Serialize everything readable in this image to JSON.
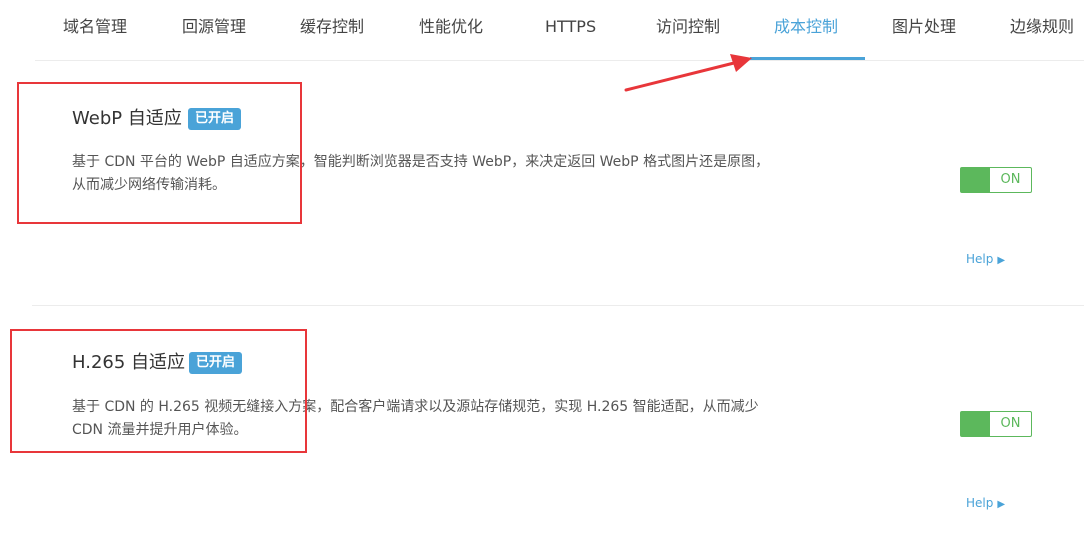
{
  "tabs": [
    {
      "label": "域名管理"
    },
    {
      "label": "回源管理"
    },
    {
      "label": "缓存控制"
    },
    {
      "label": "性能优化"
    },
    {
      "label": "HTTPS"
    },
    {
      "label": "访问控制"
    },
    {
      "label": "成本控制",
      "active": true
    },
    {
      "label": "图片处理"
    },
    {
      "label": "边缘规则"
    }
  ],
  "features": [
    {
      "title": "WebP 自适应",
      "badge": "已开启",
      "description": "基于 CDN 平台的 WebP 自适应方案，智能判断浏览器是否支持 WebP，来决定返回 WebP 格式图片还是原图，从而减少网络传输消耗。",
      "toggle_state": "ON",
      "help_label": "Help"
    },
    {
      "title": "H.265 自适应",
      "badge": "已开启",
      "description": "基于 CDN 的 H.265 视频无缝接入方案，配合客户端请求以及源站存储规范，实现 H.265 智能适配，从而减少 CDN 流量并提升用户体验。",
      "toggle_state": "ON",
      "help_label": "Help"
    }
  ],
  "colors": {
    "accent": "#4aa3d8",
    "toggle_on": "#5cb85c",
    "annotation": "#e8363a"
  }
}
